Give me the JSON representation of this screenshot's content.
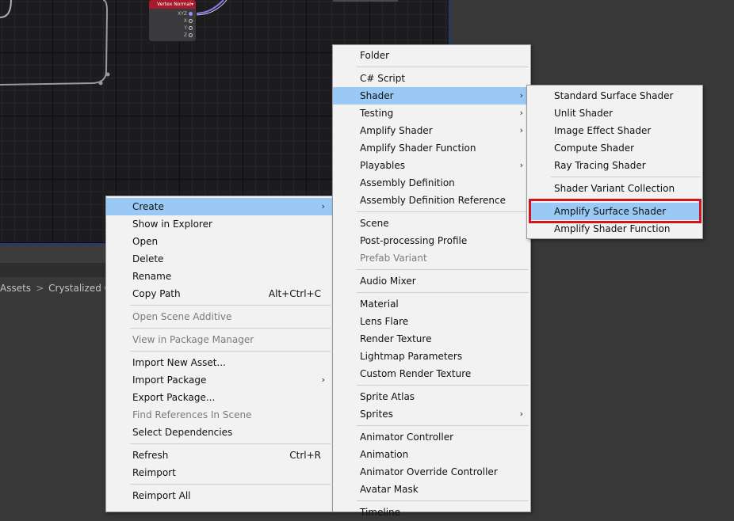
{
  "graph": {
    "node": {
      "title": "Vertex Normal",
      "ports": [
        "XYZ",
        "X",
        "Y",
        "Z"
      ]
    }
  },
  "breadcrumb": [
    "Assets",
    "Crystalized Cl"
  ],
  "context_menu": {
    "items": [
      {
        "label": "Create",
        "submenu": true,
        "highlighted": true
      },
      {
        "label": "Show in Explorer"
      },
      {
        "label": "Open"
      },
      {
        "label": "Delete"
      },
      {
        "label": "Rename"
      },
      {
        "label": "Copy Path",
        "shortcut": "Alt+Ctrl+C"
      },
      {
        "sep": true
      },
      {
        "label": "Open Scene Additive",
        "disabled": true
      },
      {
        "sep": true
      },
      {
        "label": "View in Package Manager",
        "disabled": true
      },
      {
        "sep": true
      },
      {
        "label": "Import New Asset..."
      },
      {
        "label": "Import Package",
        "submenu": true
      },
      {
        "label": "Export Package..."
      },
      {
        "label": "Find References In Scene",
        "disabled": true
      },
      {
        "label": "Select Dependencies"
      },
      {
        "sep": true
      },
      {
        "label": "Refresh",
        "shortcut": "Ctrl+R"
      },
      {
        "label": "Reimport"
      },
      {
        "sep": true
      },
      {
        "label": "Reimport All"
      }
    ]
  },
  "create_menu": {
    "items": [
      {
        "label": "Folder"
      },
      {
        "sep": true
      },
      {
        "label": "C# Script"
      },
      {
        "label": "Shader",
        "submenu": true,
        "highlighted": true
      },
      {
        "label": "Testing",
        "submenu": true
      },
      {
        "label": "Amplify Shader",
        "submenu": true
      },
      {
        "label": "Amplify Shader Function"
      },
      {
        "label": "Playables",
        "submenu": true
      },
      {
        "label": "Assembly Definition"
      },
      {
        "label": "Assembly Definition Reference"
      },
      {
        "sep": true
      },
      {
        "label": "Scene"
      },
      {
        "label": "Post-processing Profile"
      },
      {
        "label": "Prefab Variant",
        "disabled": true
      },
      {
        "sep": true
      },
      {
        "label": "Audio Mixer"
      },
      {
        "sep": true
      },
      {
        "label": "Material"
      },
      {
        "label": "Lens Flare"
      },
      {
        "label": "Render Texture"
      },
      {
        "label": "Lightmap Parameters"
      },
      {
        "label": "Custom Render Texture"
      },
      {
        "sep": true
      },
      {
        "label": "Sprite Atlas"
      },
      {
        "label": "Sprites",
        "submenu": true
      },
      {
        "sep": true
      },
      {
        "label": "Animator Controller"
      },
      {
        "label": "Animation"
      },
      {
        "label": "Animator Override Controller"
      },
      {
        "label": "Avatar Mask"
      },
      {
        "sep": true
      },
      {
        "label": "Timeline"
      }
    ]
  },
  "shader_menu": {
    "items": [
      {
        "label": "Standard Surface Shader"
      },
      {
        "label": "Unlit Shader"
      },
      {
        "label": "Image Effect Shader"
      },
      {
        "label": "Compute Shader"
      },
      {
        "label": "Ray Tracing Shader"
      },
      {
        "sep": true
      },
      {
        "label": "Shader Variant Collection"
      },
      {
        "sep": true
      },
      {
        "label": "Amplify Surface Shader",
        "highlighted": true
      },
      {
        "label": "Amplify Shader Function"
      }
    ]
  },
  "colors": {
    "highlight": "#99c9f4",
    "callout": "#d4141c",
    "node_header": "#a8192e"
  }
}
